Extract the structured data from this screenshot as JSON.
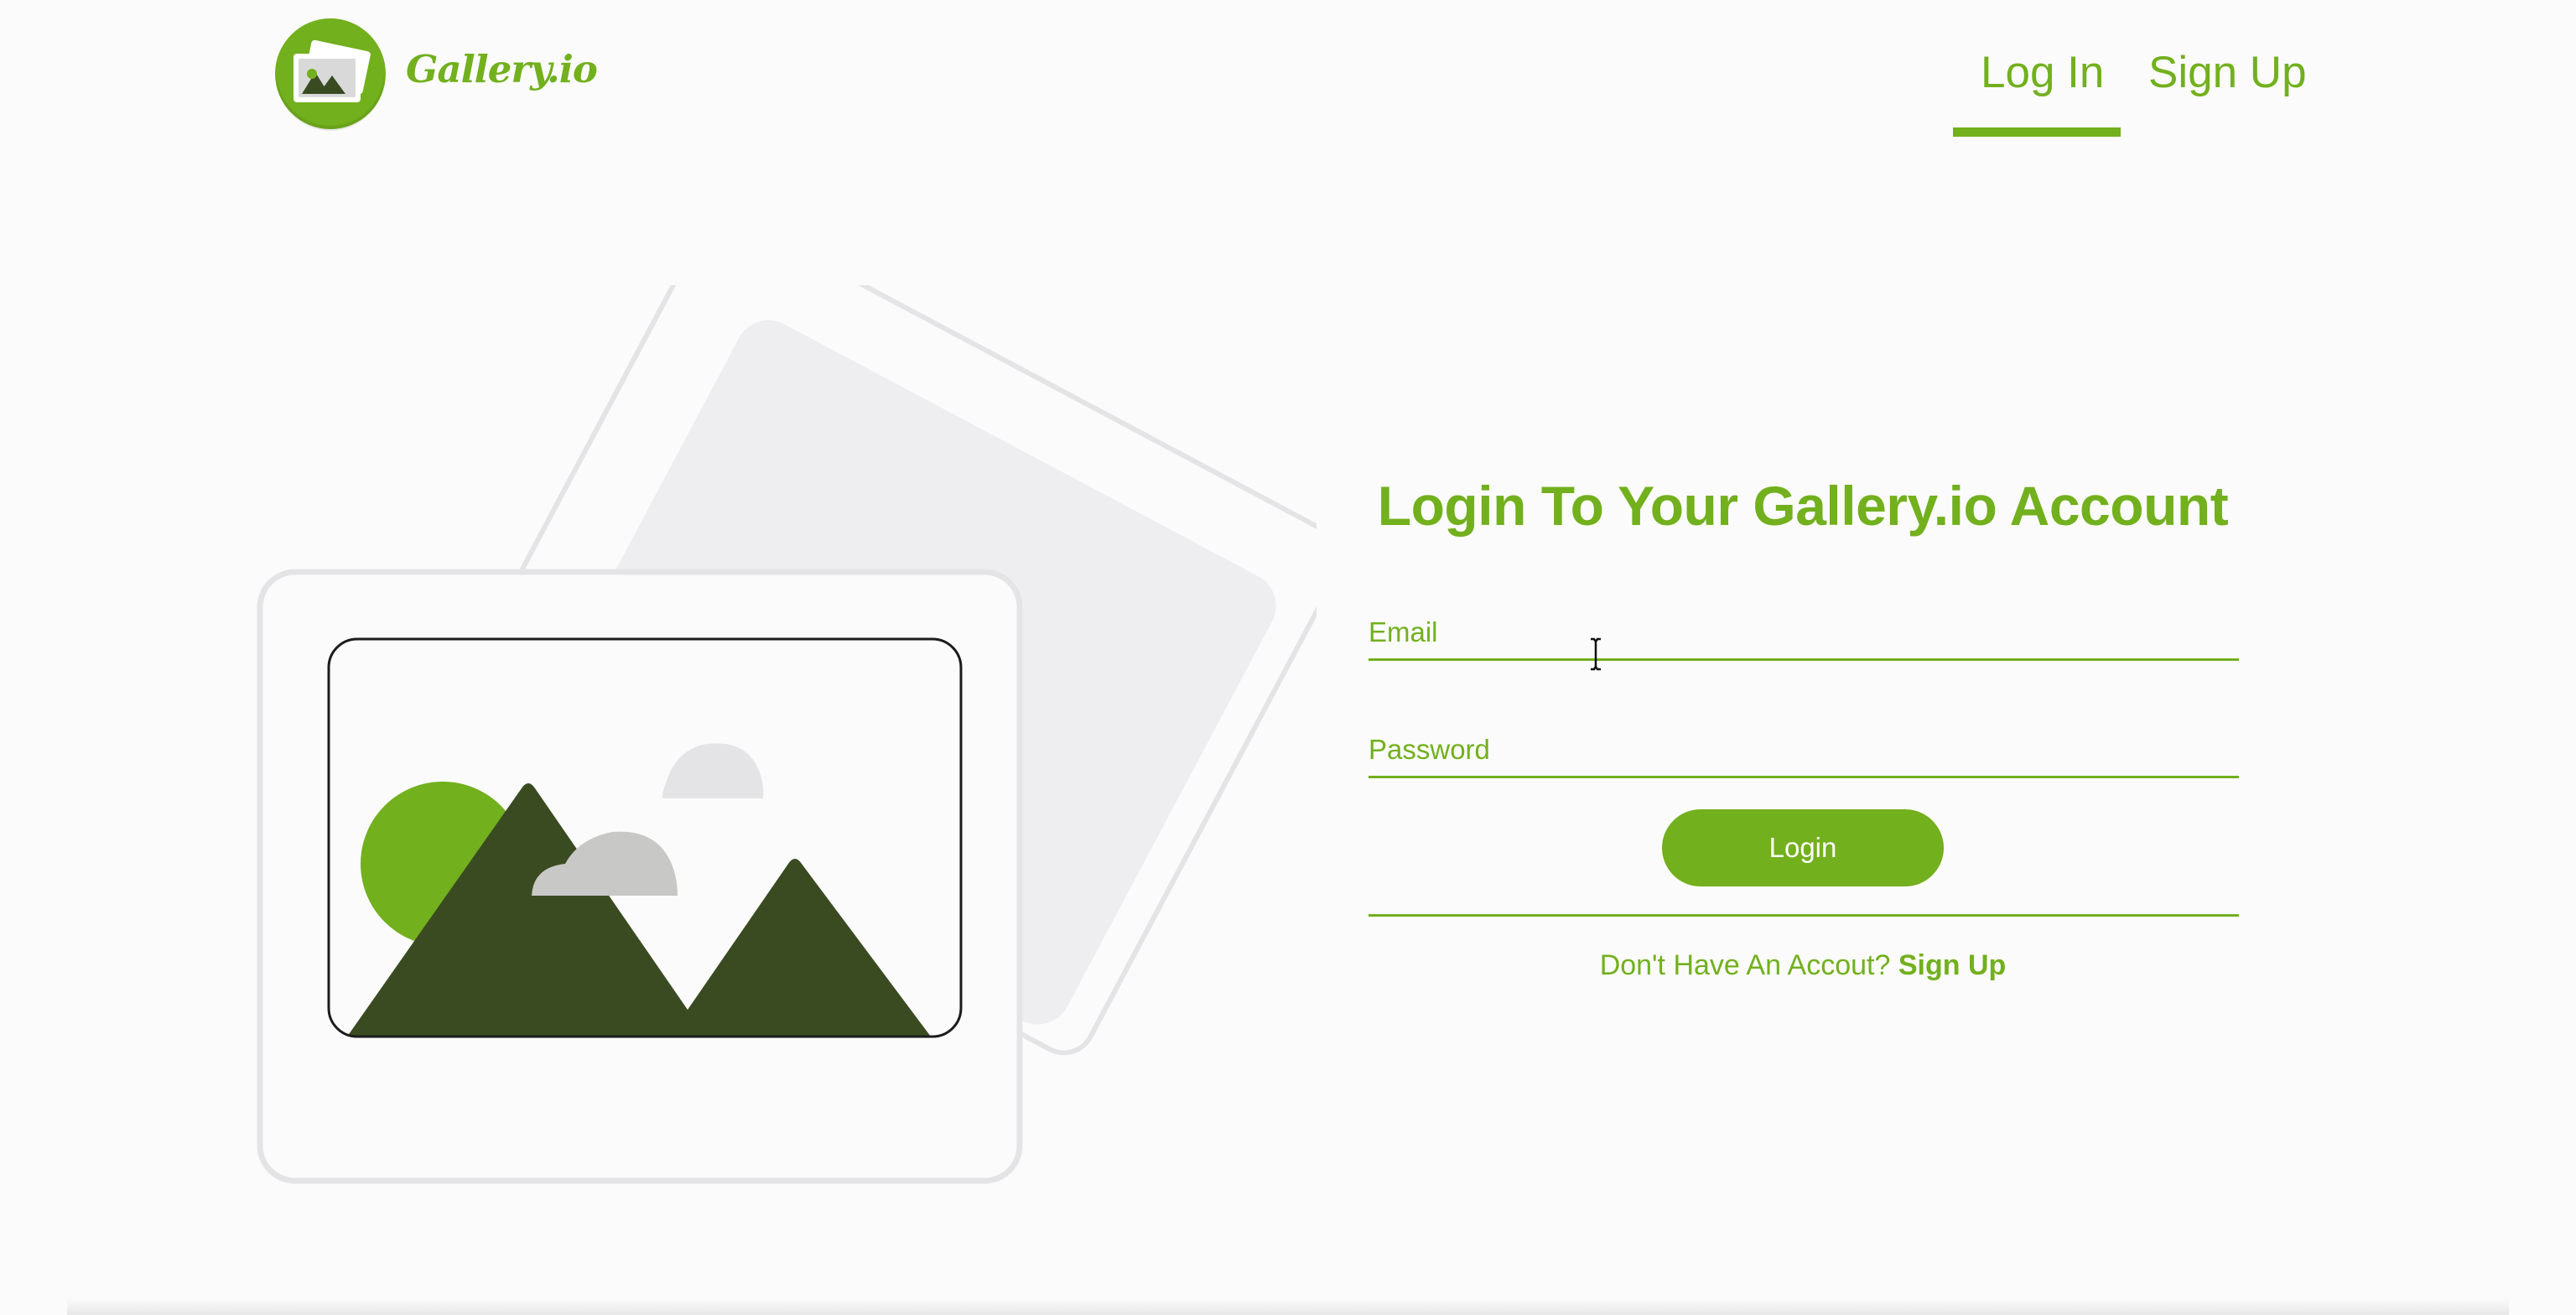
{
  "brand": {
    "name": "Gallery.io",
    "color": "#72b01d",
    "dark_color": "#3a4b22"
  },
  "nav": {
    "login_label": "Log In",
    "signup_label": "Sign Up",
    "active": "login"
  },
  "form": {
    "title": "Login To Your Gallery.io Account",
    "email_placeholder": "Email",
    "email_value": "",
    "password_placeholder": "Password",
    "password_value": "",
    "login_button": "Login",
    "signup_prompt": "Don't Have An Accout?",
    "signup_link": "Sign Up"
  },
  "icons": {
    "logo": "photo-stack-icon",
    "illustration": "landscape-photo-illustration",
    "cursor": "text-cursor-icon"
  }
}
